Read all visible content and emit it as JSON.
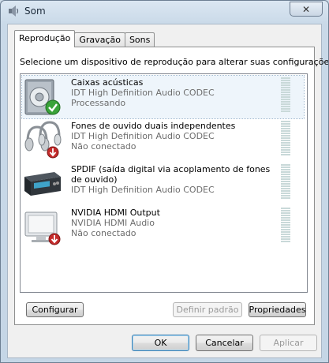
{
  "window": {
    "title": "Som",
    "close_icon": "close-icon"
  },
  "tabs": [
    {
      "label": "Reprodução",
      "active": true
    },
    {
      "label": "Gravação",
      "active": false
    },
    {
      "label": "Sons",
      "active": false
    }
  ],
  "instruction": "Selecione um dispositivo de reprodução para alterar suas configurações:",
  "devices": [
    {
      "name": "Caixas acústicas",
      "driver": "IDT High Definition Audio CODEC",
      "status": "Processando",
      "icon": "speaker-icon",
      "badge": "default-checkmark-icon",
      "selected": true
    },
    {
      "name": "Fones de ouvido duais independentes",
      "driver": "IDT High Definition Audio CODEC",
      "status": "Não conectado",
      "icon": "headphones-icon",
      "badge": "disconnected-arrow-icon",
      "selected": false
    },
    {
      "name": "SPDIF (saída digital via acoplamento de fones de ouvido)",
      "driver": "IDT High Definition Audio CODEC",
      "status": "",
      "icon": "spdif-device-icon",
      "badge": "",
      "selected": false
    },
    {
      "name": "NVIDIA HDMI Output",
      "driver": "NVIDIA HDMI Audio",
      "status": "Não conectado",
      "icon": "monitor-icon",
      "badge": "disconnected-arrow-icon",
      "selected": false
    }
  ],
  "panel_buttons": {
    "configure": "Configurar",
    "set_default": "Definir padrão",
    "properties": "Propriedades"
  },
  "dialog_buttons": {
    "ok": "OK",
    "cancel": "Cancelar",
    "apply": "Aplicar"
  }
}
